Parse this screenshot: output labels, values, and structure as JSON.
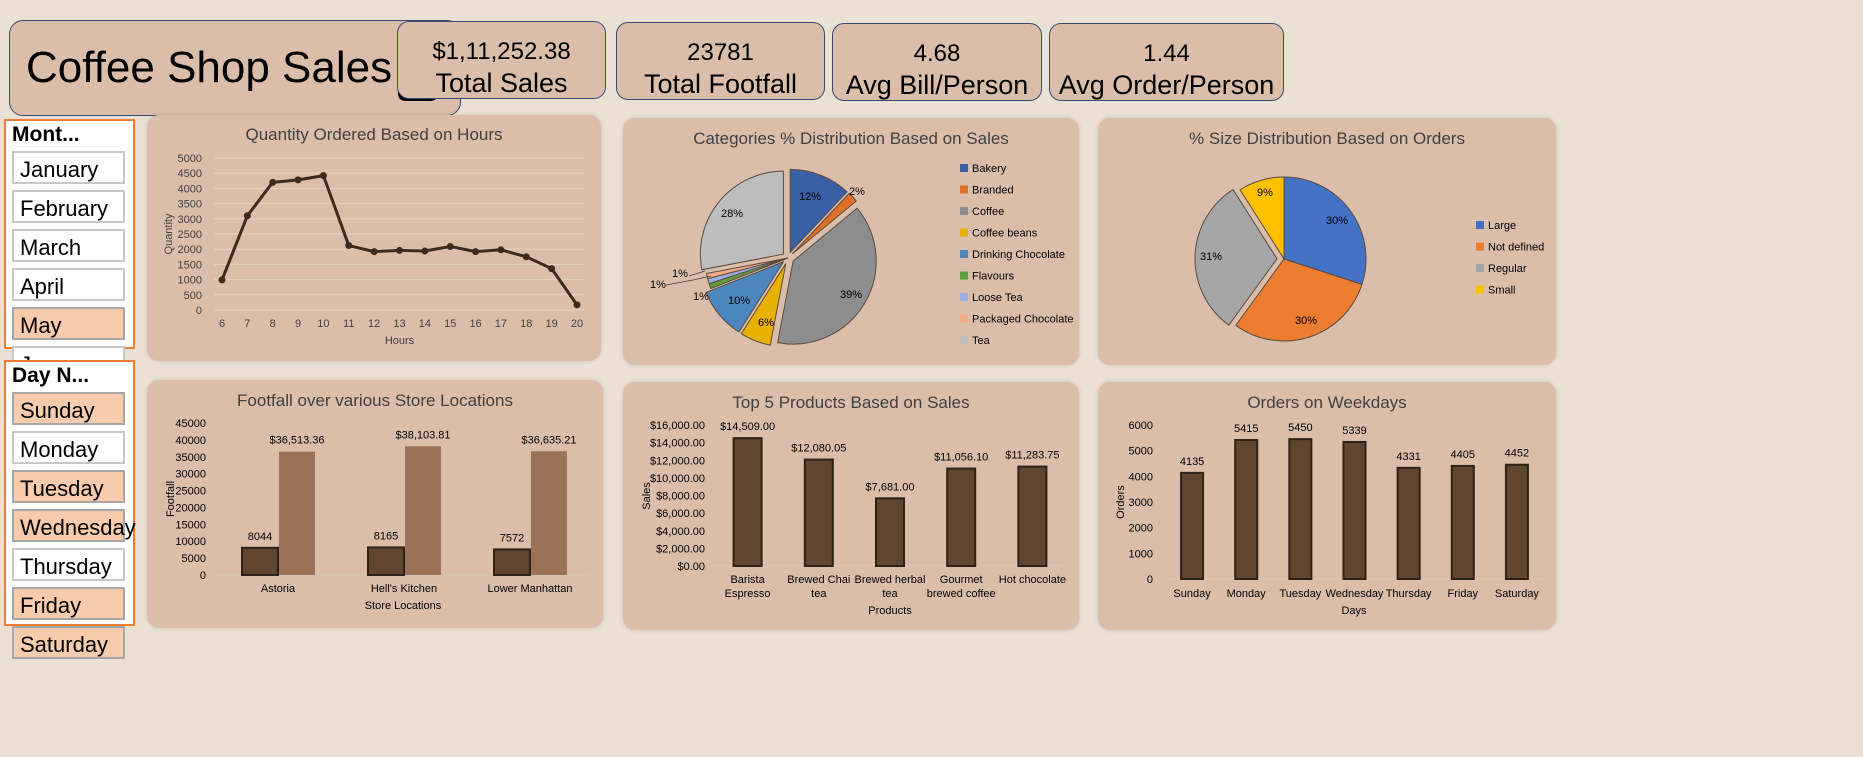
{
  "title": "Coffee Shop Sales",
  "kpis": [
    {
      "value": "$1,11,252.38",
      "label": "Total Sales"
    },
    {
      "value": "23781",
      "label": "Total Footfall"
    },
    {
      "value": "4.68",
      "label": "Avg Bill/Person"
    },
    {
      "value": "1.44",
      "label": "Avg Order/Person"
    }
  ],
  "month_slicer": {
    "header": "Mont...",
    "items": [
      {
        "label": "January",
        "selected": false
      },
      {
        "label": "February",
        "selected": false
      },
      {
        "label": "March",
        "selected": false
      },
      {
        "label": "April",
        "selected": false
      },
      {
        "label": "May",
        "selected": true
      },
      {
        "label": "June",
        "selected": false
      }
    ]
  },
  "day_slicer": {
    "header": "Day N...",
    "items": [
      {
        "label": "Sunday",
        "selected": true
      },
      {
        "label": "Monday",
        "selected": false
      },
      {
        "label": "Tuesday",
        "selected": true
      },
      {
        "label": "Wednesday",
        "selected": true
      },
      {
        "label": "Thursday",
        "selected": false
      },
      {
        "label": "Friday",
        "selected": true
      },
      {
        "label": "Saturday",
        "selected": true
      }
    ]
  },
  "colors": {
    "dark_brown": "#5e4631",
    "light_brown": "#9a7258",
    "line": "#3d2b1f"
  },
  "chart_data": [
    {
      "id": "hours",
      "type": "line",
      "title": "Quantity Ordered Based on Hours",
      "xlabel": "Hours",
      "ylabel": "Quantity",
      "x": [
        6,
        7,
        8,
        9,
        10,
        11,
        12,
        13,
        14,
        15,
        16,
        17,
        18,
        19,
        20
      ],
      "values": [
        990,
        3100,
        4200,
        4280,
        4420,
        2120,
        1920,
        1960,
        1940,
        2090,
        1920,
        1980,
        1750,
        1360,
        170
      ],
      "ylim": [
        0,
        5000
      ],
      "yticks": [
        0,
        500,
        1000,
        1500,
        2000,
        2500,
        3000,
        3500,
        4000,
        4500,
        5000
      ]
    },
    {
      "id": "categories",
      "type": "pie",
      "title": "Categories % Distribution Based on Sales",
      "labels": [
        "Bakery",
        "Branded",
        "Coffee",
        "Coffee beans",
        "Drinking Chocolate",
        "Flavours",
        "Loose Tea",
        "Packaged Chocolate",
        "Tea"
      ],
      "values": [
        12,
        2,
        39,
        6,
        10,
        1,
        1,
        1,
        28
      ],
      "data_labels": [
        "12%",
        "2%",
        "39%",
        "6%",
        "10%",
        "1%",
        "1%",
        "1%",
        "28%"
      ],
      "colors": [
        "#3b5fa5",
        "#e07025",
        "#8d8d8d",
        "#e8b100",
        "#4c86bf",
        "#5f9d3d",
        "#9aaee0",
        "#f5aa86",
        "#bdbdbd"
      ]
    },
    {
      "id": "sizes",
      "type": "pie",
      "title": "% Size Distribution Based on Orders",
      "labels": [
        "Large",
        "Not defined",
        "Regular",
        "Small"
      ],
      "values": [
        30,
        30,
        31,
        9
      ],
      "data_labels": [
        "30%",
        "30%",
        "31%",
        "9%"
      ],
      "colors": [
        "#4472c4",
        "#ed7d31",
        "#a5a5a5",
        "#ffc000"
      ]
    },
    {
      "id": "footfall",
      "type": "bar",
      "title": "Footfall over various Store Locations",
      "xlabel": "Store Locations",
      "ylabel": "Footfall",
      "categories": [
        "Astoria",
        "Hell's Kitchen",
        "Lower Manhattan"
      ],
      "series": [
        {
          "values": [
            8044,
            8165,
            7572
          ],
          "labels": [
            "8044",
            "8165",
            "7572"
          ]
        },
        {
          "values": [
            36513.36,
            38103.81,
            36635.21
          ],
          "labels": [
            "$36,513.36",
            "$38,103.81",
            "$36,635.21"
          ]
        }
      ],
      "ylim": [
        0,
        45000
      ],
      "yticks": [
        0,
        5000,
        10000,
        15000,
        20000,
        25000,
        30000,
        35000,
        40000,
        45000
      ]
    },
    {
      "id": "products",
      "type": "bar",
      "title": "Top 5 Products Based on Sales",
      "xlabel": "Products",
      "ylabel": "Sales",
      "categories": [
        [
          "Barista",
          "Espresso"
        ],
        [
          "Brewed Chai",
          "tea"
        ],
        [
          "Brewed herbal",
          "tea"
        ],
        [
          "Gourmet",
          "brewed coffee"
        ],
        [
          "Hot chocolate"
        ]
      ],
      "values": [
        14509,
        12080.05,
        7681,
        11056.1,
        11283.75
      ],
      "labels": [
        "$14,509.00",
        "$12,080.05",
        "$7,681.00",
        "$11,056.10",
        "$11,283.75"
      ],
      "ylim": [
        0,
        16000
      ],
      "yticks": [
        "$0.00",
        "$2,000.00",
        "$4,000.00",
        "$6,000.00",
        "$8,000.00",
        "$10,000.00",
        "$12,000.00",
        "$14,000.00",
        "$16,000.00"
      ]
    },
    {
      "id": "weekdays",
      "type": "bar",
      "title": "Orders on Weekdays",
      "xlabel": "Days",
      "ylabel": "Orders",
      "categories": [
        "Sunday",
        "Monday",
        "Tuesday",
        "Wednesday",
        "Thursday",
        "Friday",
        "Saturday"
      ],
      "values": [
        4135,
        5415,
        5450,
        5339,
        4331,
        4405,
        4452
      ],
      "ylim": [
        0,
        6000
      ],
      "yticks": [
        0,
        1000,
        2000,
        3000,
        4000,
        5000,
        6000
      ]
    }
  ]
}
